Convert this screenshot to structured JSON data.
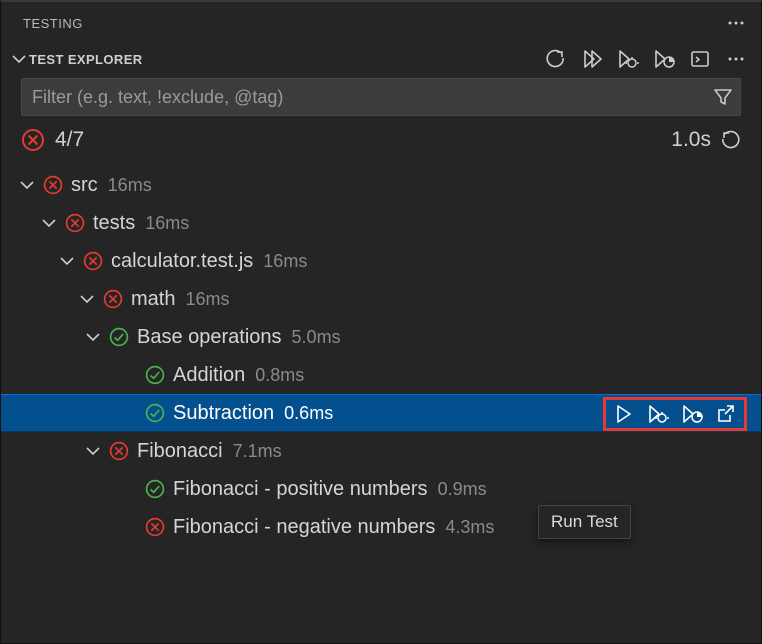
{
  "colors": {
    "pass": "#4caf50",
    "fail": "#e53a2f",
    "selected": "#04508f"
  },
  "header": {
    "panel_title": "TESTING",
    "section_title": "TEST EXPLORER"
  },
  "filter": {
    "placeholder": "Filter (e.g. text, !exclude, @tag)",
    "value": ""
  },
  "summary": {
    "count_text": "4/7",
    "duration": "1.0s"
  },
  "tooltip": {
    "run_test": "Run Test"
  },
  "tree": {
    "src": {
      "name": "src",
      "dur": "16ms"
    },
    "tests": {
      "name": "tests",
      "dur": "16ms"
    },
    "file": {
      "name": "calculator.test.js",
      "dur": "16ms"
    },
    "math": {
      "name": "math",
      "dur": "16ms"
    },
    "baseops": {
      "name": "Base operations",
      "dur": "5.0ms"
    },
    "addition": {
      "name": "Addition",
      "dur": "0.8ms"
    },
    "subtraction": {
      "name": "Subtraction",
      "dur": "0.6ms"
    },
    "fibonacci": {
      "name": "Fibonacci",
      "dur": "7.1ms"
    },
    "fib_pos": {
      "name": "Fibonacci - positive numbers",
      "dur": "0.9ms"
    },
    "fib_neg": {
      "name": "Fibonacci - negative numbers",
      "dur": "4.3ms"
    }
  }
}
